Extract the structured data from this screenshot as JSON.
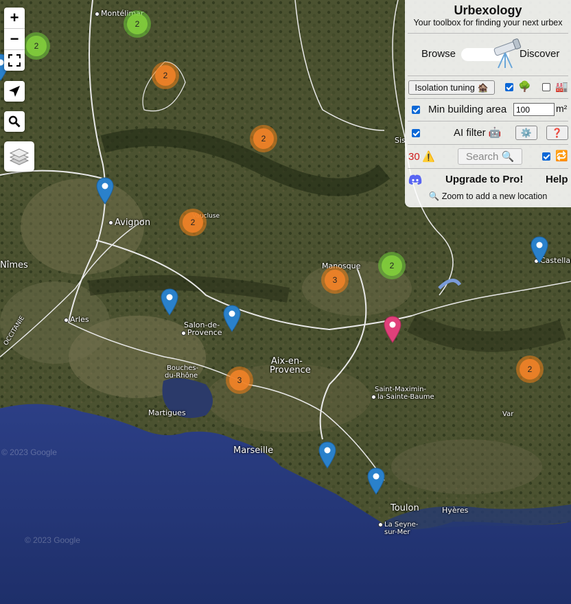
{
  "map": {
    "attribution_watermark": "© 2023 Google",
    "places": [
      {
        "name": "Montélimar",
        "dot": true
      },
      {
        "name": "Avignon",
        "dot": true,
        "big": true
      },
      {
        "name": "Vaucluse",
        "dot": false
      },
      {
        "name": "Nîmes",
        "dot": false,
        "big": true
      },
      {
        "name": "Arles",
        "dot": true
      },
      {
        "name": "OCCITANIE",
        "dot": false
      },
      {
        "name": "Salon-de-",
        "dot": false
      },
      {
        "name": "Provence",
        "dot": true
      },
      {
        "name": "Bouches-",
        "dot": false
      },
      {
        "name": "du-Rhône",
        "dot": false
      },
      {
        "name": "Martigues",
        "dot": true
      },
      {
        "name": "Aix-en-",
        "dot": false,
        "big": true
      },
      {
        "name": "Provence",
        "dot": false,
        "big": true
      },
      {
        "name": "Manosque",
        "dot": true
      },
      {
        "name": "Sis",
        "dot": false
      },
      {
        "name": "Castellane",
        "dot": true
      },
      {
        "name": "Saint-Maximin-",
        "dot": false
      },
      {
        "name": "la-Sainte-Baume",
        "dot": true
      },
      {
        "name": "Var",
        "dot": false
      },
      {
        "name": "Marseille",
        "dot": false,
        "big": true
      },
      {
        "name": "Toulon",
        "dot": false,
        "big": true
      },
      {
        "name": "La Seyne-",
        "dot": true
      },
      {
        "name": "sur-Mer",
        "dot": false
      },
      {
        "name": "Hyères",
        "dot": false
      }
    ],
    "clusters": [
      {
        "count": "2",
        "color": "green"
      },
      {
        "count": "2",
        "color": "green"
      },
      {
        "count": "2",
        "color": "orange"
      },
      {
        "count": "2",
        "color": "orange"
      },
      {
        "count": "2",
        "color": "orange"
      },
      {
        "count": "3",
        "color": "orange"
      },
      {
        "count": "2",
        "color": "green"
      },
      {
        "count": "3",
        "color": "orange"
      },
      {
        "count": "2",
        "color": "orange"
      }
    ],
    "pin_colors": {
      "blue": "#2a81cb",
      "pink": "#e0407a"
    }
  },
  "controls": {
    "zoom_in": "+",
    "zoom_out": "−"
  },
  "panel": {
    "title": "Urbexology",
    "subtitle": "Your toolbox for finding your next urbex",
    "browse_label": "Browse",
    "discover_label": "Discover",
    "isolation_button": "Isolation tuning 🏚️",
    "nature_icon": "🌳",
    "building_icon": "🏭",
    "min_area_label": "Min building area",
    "min_area_value": "100",
    "min_area_unit": "m²",
    "ai_filter_label": "AI filter 🤖",
    "settings_button": "⚙️",
    "help_button": "❓",
    "warning_count": "30",
    "warning_icon": "⚠️",
    "search_button": "Search 🔍",
    "repeat_icon": "🔁",
    "upgrade_label": "Upgrade to Pro!",
    "help_label": "Help",
    "zoom_hint": "🔍 Zoom to add a new location",
    "checks": {
      "nature": true,
      "building": false,
      "min_area": true,
      "ai_filter": true,
      "auto": true
    }
  }
}
